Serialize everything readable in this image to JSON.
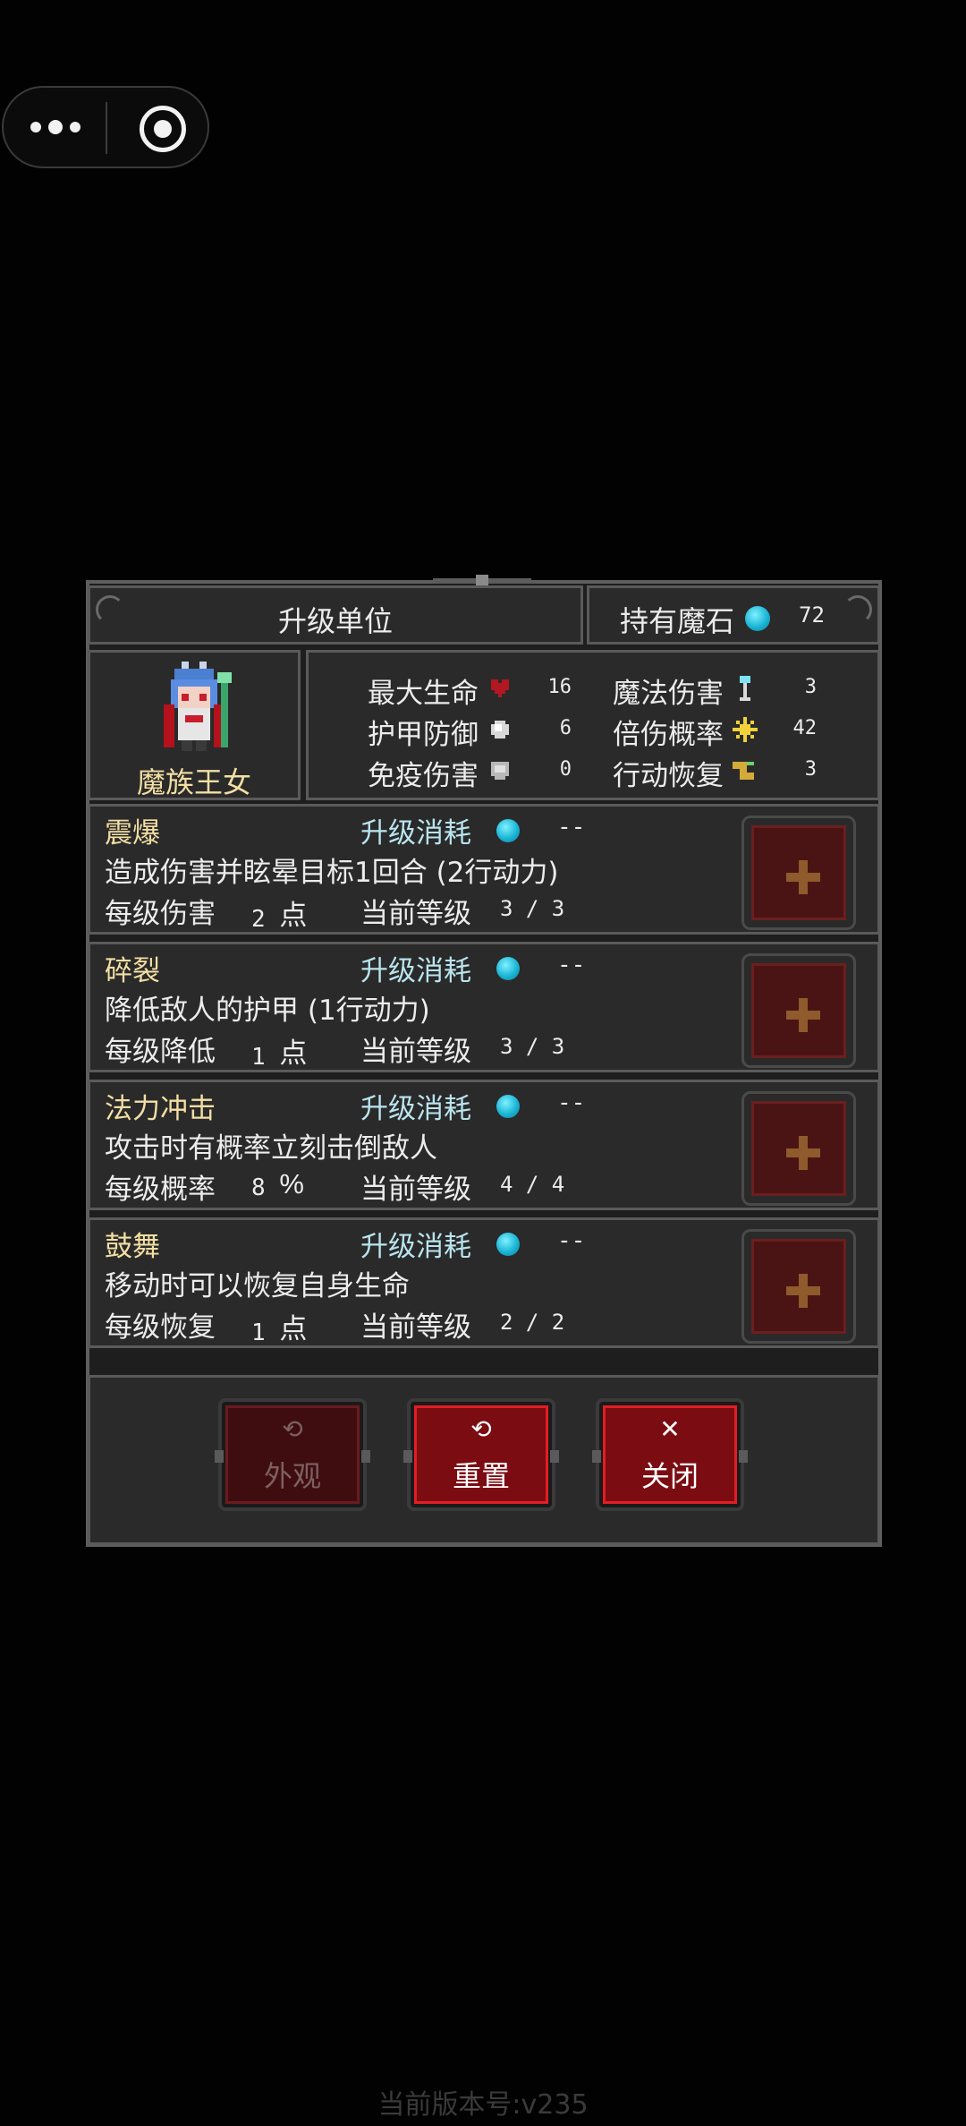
{
  "title": "升级单位",
  "mana": {
    "label": "持有魔石",
    "value": "72"
  },
  "hero": {
    "name": "魔族王女"
  },
  "stats": [
    {
      "label": "最大生命",
      "icon": "heart-icon",
      "value": "16"
    },
    {
      "label": "护甲防御",
      "icon": "armor-icon",
      "value": "6"
    },
    {
      "label": "免疫伤害",
      "icon": "shield-icon",
      "value": "0"
    },
    {
      "label": "魔法伤害",
      "icon": "staff-icon",
      "value": "3"
    },
    {
      "label": "倍伤概率",
      "icon": "burst-icon",
      "value": "42"
    },
    {
      "label": "行动恢复",
      "icon": "boot-icon",
      "value": "3"
    }
  ],
  "skills": [
    {
      "name": "震爆",
      "cost_label": "升级消耗",
      "cost": "--",
      "desc": "造成伤害并眩晕目标1回合 (2行动力)",
      "per_label": "每级伤害",
      "per_value": "2",
      "per_unit": "点",
      "level_label": "当前等级",
      "level": "3 / 3"
    },
    {
      "name": "碎裂",
      "cost_label": "升级消耗",
      "cost": "--",
      "desc": "降低敌人的护甲 (1行动力)",
      "per_label": "每级降低",
      "per_value": "1",
      "per_unit": "点",
      "level_label": "当前等级",
      "level": "3 / 3"
    },
    {
      "name": "法力冲击",
      "cost_label": "升级消耗",
      "cost": "--",
      "desc": "攻击时有概率立刻击倒敌人",
      "per_label": "每级概率",
      "per_value": "8",
      "per_unit": "%",
      "level_label": "当前等级",
      "level": "4 / 4"
    },
    {
      "name": "鼓舞",
      "cost_label": "升级消耗",
      "cost": "--",
      "desc": "移动时可以恢复自身生命",
      "per_label": "每级恢复",
      "per_value": "1",
      "per_unit": "点",
      "level_label": "当前等级",
      "level": "2 / 2"
    }
  ],
  "buttons": {
    "appearance": {
      "symbol": "⟲",
      "label": "外观"
    },
    "reset": {
      "symbol": "⟲",
      "label": "重置"
    },
    "close": {
      "symbol": "✕",
      "label": "关闭"
    }
  },
  "version": "当前版本号:v235",
  "colors": {
    "gem": "#1bb5d6",
    "button_red": "#7b0c12",
    "gold_text": "#f3dfa4"
  }
}
